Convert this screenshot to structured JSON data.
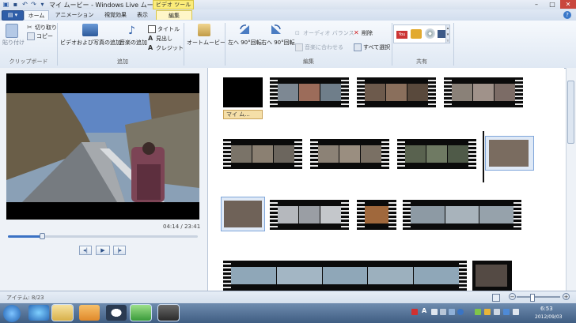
{
  "window": {
    "title": "マイ ムービー - Windows Live ムービー ...",
    "context_tab": "ビデオ ツール"
  },
  "tabs": [
    {
      "label": "ホーム"
    },
    {
      "label": "アニメーション"
    },
    {
      "label": "視覚効果"
    },
    {
      "label": "表示"
    },
    {
      "label": "編集"
    }
  ],
  "ribbon": {
    "clipboard": {
      "paste": "貼り付け",
      "cut": "切り取り",
      "copy": "コピー",
      "group": "クリップボード"
    },
    "add": {
      "add_videos_photos": "ビデオおよび写真の追加",
      "add_music": "音楽の追加",
      "title": "タイトル",
      "caption": "見出し",
      "credits": "クレジット",
      "group": "追加"
    },
    "automovie": "オートムービー",
    "editing": {
      "rotate_left": "左へ 90°回転",
      "rotate_right": "右へ 90°回転",
      "audio_balance": "オーディオ バランス",
      "fit_to_music": "音楽に合わせる",
      "remove": "削除",
      "select_all": "すべて選択",
      "group": "編集"
    },
    "share": {
      "group": "共有",
      "youtube_label": "You"
    }
  },
  "preview": {
    "time": "04:14 / 23:41",
    "progress": 0.18
  },
  "storyboard": {
    "title_caption": "マイ ム..."
  },
  "status": {
    "items": "アイテム: 8/23"
  },
  "taskbar": {
    "time": "6:53",
    "date": "2012/09/03",
    "ime": "A"
  },
  "colors": {
    "accent": "#2f5ea8",
    "context_tab": "#fbec7a",
    "selection": "#7fa6da"
  }
}
